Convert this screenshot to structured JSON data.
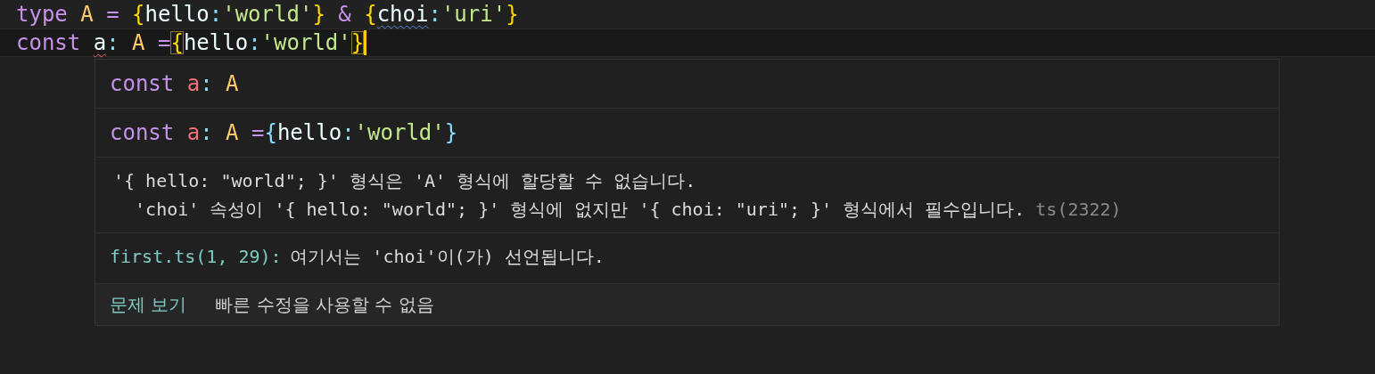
{
  "editor": {
    "lines": [
      {
        "current": false,
        "tokens": [
          {
            "text": "type ",
            "kind": "keyword"
          },
          {
            "text": "A ",
            "kind": "type"
          },
          {
            "text": "= ",
            "kind": "operator"
          },
          {
            "text": "{",
            "kind": "brace"
          },
          {
            "text": "hello",
            "kind": "property"
          },
          {
            "text": ":",
            "kind": "punct"
          },
          {
            "text": "'world'",
            "kind": "string"
          },
          {
            "text": "}",
            "kind": "brace"
          },
          {
            "text": " & ",
            "kind": "operator"
          },
          {
            "text": "{",
            "kind": "brace"
          },
          {
            "text": "choi",
            "kind": "property",
            "warning": true
          },
          {
            "text": ":",
            "kind": "punct"
          },
          {
            "text": "'uri'",
            "kind": "string"
          },
          {
            "text": "}",
            "kind": "brace"
          }
        ]
      },
      {
        "current": true,
        "tokens": [
          {
            "text": "const ",
            "kind": "keyword"
          },
          {
            "text": "a",
            "kind": "plain",
            "error": true
          },
          {
            "text": ": ",
            "kind": "punct"
          },
          {
            "text": "A ",
            "kind": "type"
          },
          {
            "text": "=",
            "kind": "operator"
          },
          {
            "text": "{",
            "kind": "brace",
            "matched": true
          },
          {
            "text": "hello",
            "kind": "property"
          },
          {
            "text": ":",
            "kind": "punct"
          },
          {
            "text": "'world'",
            "kind": "string"
          },
          {
            "text": "}",
            "kind": "brace",
            "matched": true
          }
        ]
      }
    ]
  },
  "hover": {
    "signature": [
      {
        "text": "const ",
        "kind": "keyword"
      },
      {
        "text": "a",
        "kind": "variable"
      },
      {
        "text": ": ",
        "kind": "punct"
      },
      {
        "text": "A",
        "kind": "type"
      }
    ],
    "code": [
      {
        "text": "const ",
        "kind": "keyword"
      },
      {
        "text": "a",
        "kind": "variable"
      },
      {
        "text": ": ",
        "kind": "punct"
      },
      {
        "text": "A ",
        "kind": "type"
      },
      {
        "text": "=",
        "kind": "operator"
      },
      {
        "text": "{",
        "kind": "brace2"
      },
      {
        "text": "hello",
        "kind": "property"
      },
      {
        "text": ":",
        "kind": "punct"
      },
      {
        "text": "'world'",
        "kind": "string"
      },
      {
        "text": "}",
        "kind": "brace2"
      }
    ],
    "message": {
      "lines": [
        "'{ hello: \"world\"; }' 형식은 'A' 형식에 할당할 수 없습니다.",
        "  'choi' 속성이 '{ hello: \"world\"; }' 형식에 없지만 '{ choi: \"uri\"; }' 형식에서 필수입니다."
      ],
      "code": "ts(2322)"
    },
    "related": {
      "location": "first.ts(1, 29):",
      "text": "여기서는 'choi'이(가) 선언됩니다."
    },
    "actions": [
      {
        "label": "문제 보기",
        "disabled": false
      },
      {
        "label": "빠른 수정을 사용할 수 없음",
        "disabled": true
      }
    ]
  }
}
